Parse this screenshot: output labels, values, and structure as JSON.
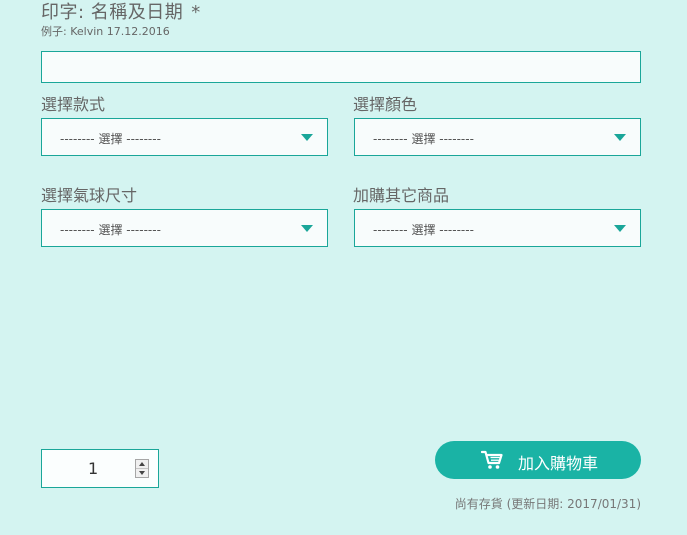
{
  "imprint": {
    "label": "印字: 名稱及日期",
    "required_mark": "*",
    "example": "例子: Kelvin 17.12.2016",
    "value": ""
  },
  "selects": {
    "style": {
      "label": "選擇款式",
      "value": "-------- 選擇 --------"
    },
    "color": {
      "label": "選擇顏色",
      "value": "-------- 選擇 --------"
    },
    "balloon_size": {
      "label": "選擇氣球尺寸",
      "value": "-------- 選擇 --------"
    },
    "addon": {
      "label": "加購其它商品",
      "value": "-------- 選擇 --------"
    }
  },
  "quantity": {
    "value": "1"
  },
  "cart_button": {
    "label": "加入購物車",
    "icon": "shopping-cart-icon"
  },
  "stock_status": "尚有存貨 (更新日期: 2017/01/31)",
  "colors": {
    "background": "#d4f4f1",
    "accent": "#1aa699",
    "button": "#1ab3a5"
  }
}
